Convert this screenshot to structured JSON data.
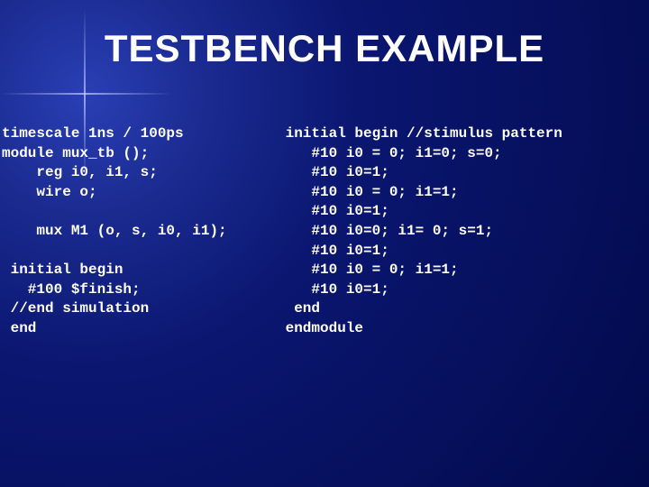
{
  "title": "TESTBENCH EXAMPLE",
  "code": {
    "left": "timescale 1ns / 100ps\nmodule mux_tb ();\n    reg i0, i1, s;\n    wire o;\n\n    mux M1 (o, s, i0, i1);\n\n initial begin\n   #100 $finish;\n //end simulation\n end",
    "right": " initial begin //stimulus pattern\n    #10 i0 = 0; i1=0; s=0;\n    #10 i0=1;\n    #10 i0 = 0; i1=1;\n    #10 i0=1;\n    #10 i0=0; i1= 0; s=1;\n    #10 i0=1;\n    #10 i0 = 0; i1=1;\n    #10 i0=1;\n  end\n endmodule"
  }
}
